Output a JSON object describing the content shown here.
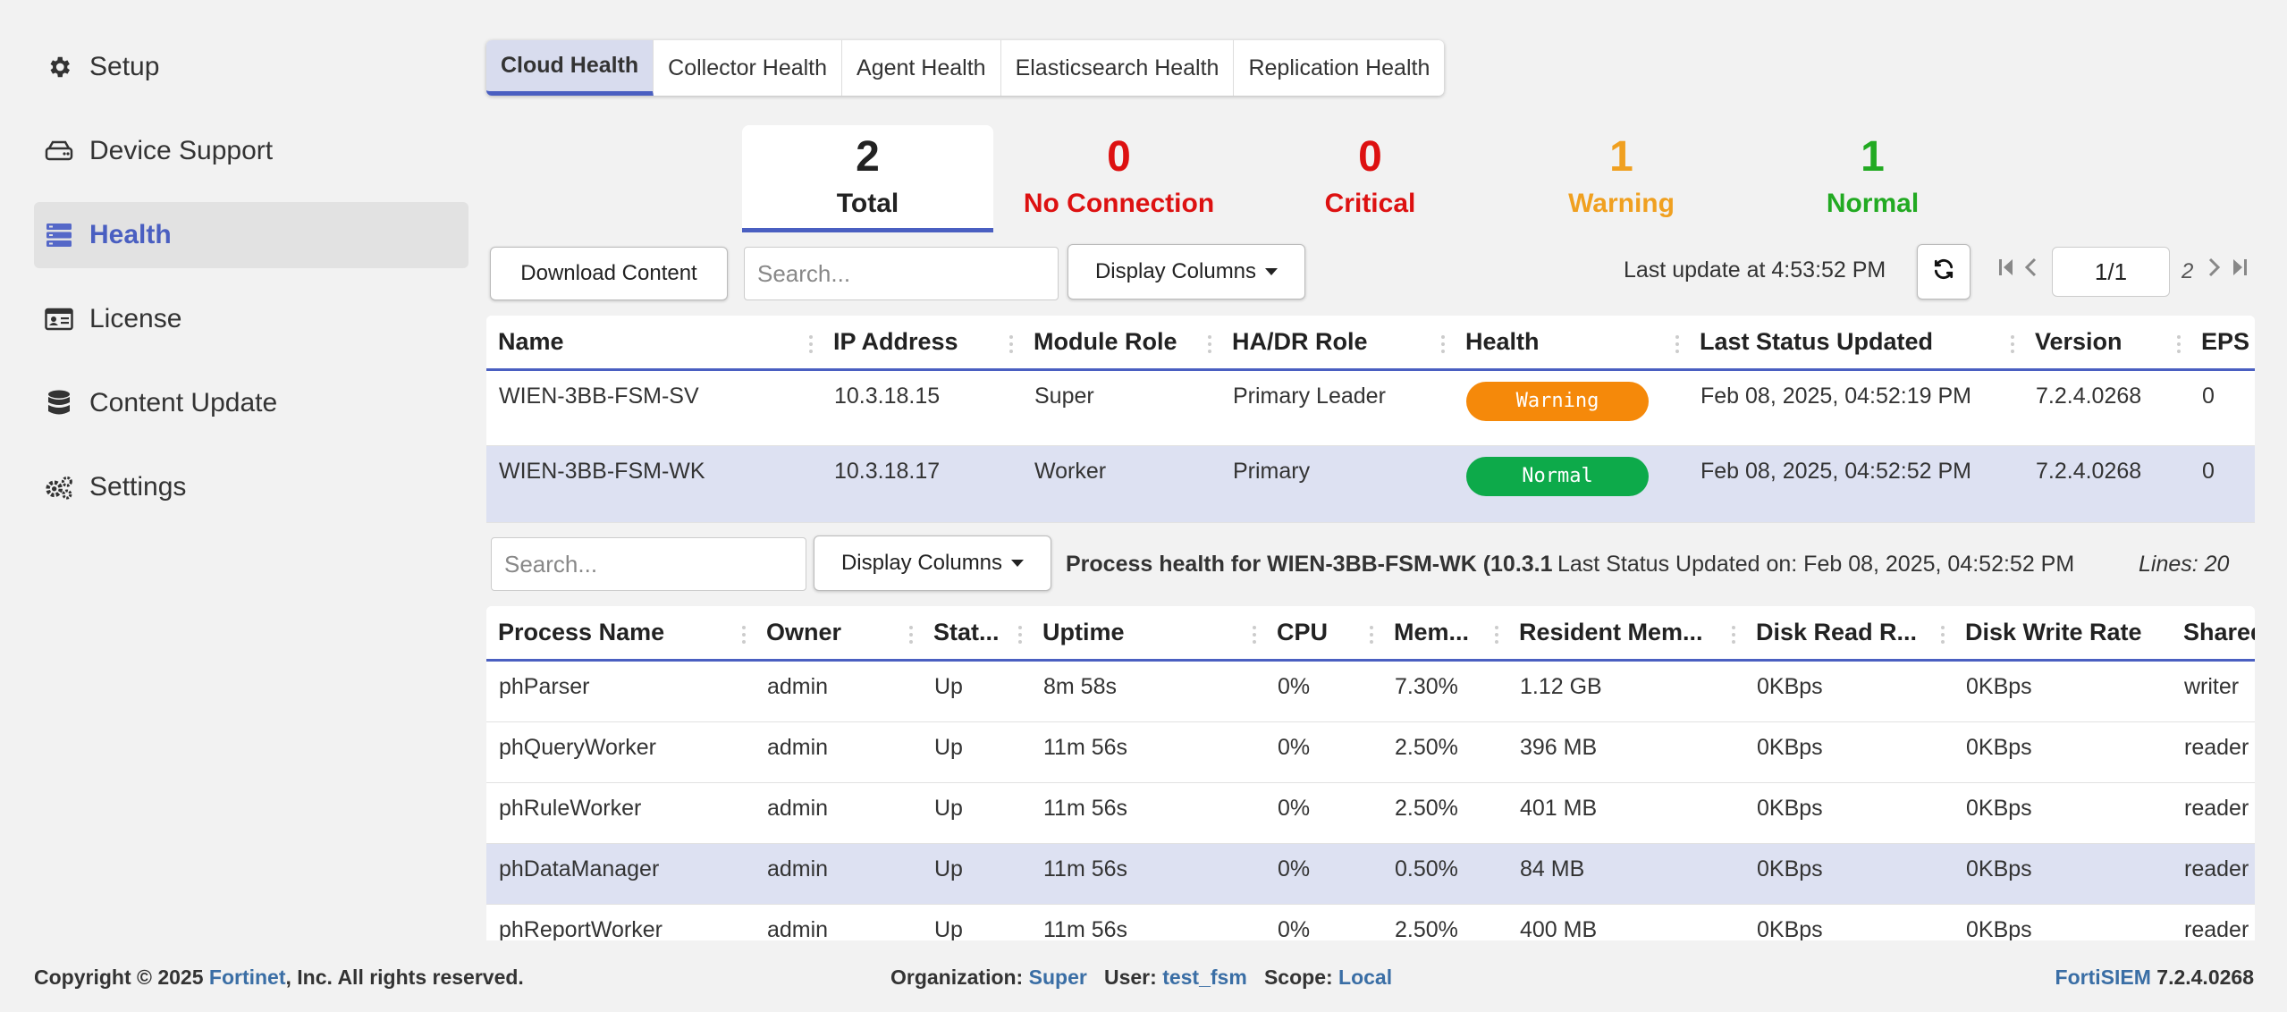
{
  "sidebar": {
    "items": [
      {
        "label": "Setup",
        "icon": "gear-icon"
      },
      {
        "label": "Device Support",
        "icon": "hard-drive-icon"
      },
      {
        "label": "Health",
        "icon": "server-icon",
        "active": true
      },
      {
        "label": "License",
        "icon": "id-card-icon"
      },
      {
        "label": "Content Update",
        "icon": "database-icon"
      },
      {
        "label": "Settings",
        "icon": "gears-icon"
      }
    ]
  },
  "tabs": [
    "Cloud Health",
    "Collector Health",
    "Agent Health",
    "Elasticsearch Health",
    "Replication Health"
  ],
  "summary": [
    {
      "count": "2",
      "label": "Total",
      "color": "#222222"
    },
    {
      "count": "0",
      "label": "No Connection",
      "color": "#dd1111"
    },
    {
      "count": "0",
      "label": "Critical",
      "color": "#dd1111"
    },
    {
      "count": "1",
      "label": "Warning",
      "color": "#f0a020"
    },
    {
      "count": "1",
      "label": "Normal",
      "color": "#22aa22"
    }
  ],
  "toolbar": {
    "download_label": "Download Content",
    "search_placeholder": "Search...",
    "display_columns_label": "Display Columns",
    "last_update": "Last update at 4:53:52 PM",
    "page_value": "1/1",
    "page_total": "2"
  },
  "nodes_table": {
    "columns": [
      "Name",
      "IP Address",
      "Module Role",
      "HA/DR Role",
      "Health",
      "Last Status Updated",
      "Version",
      "EPS"
    ],
    "rows": [
      {
        "name": "WIEN-3BB-FSM-SV",
        "ip": "10.3.18.15",
        "module_role": "Super",
        "hadr_role": "Primary Leader",
        "health": "Warning",
        "health_color": "#f5890a",
        "last_updated": "Feb 08, 2025, 04:52:19 PM",
        "version": "7.2.4.0268",
        "eps": "0"
      },
      {
        "name": "WIEN-3BB-FSM-WK",
        "ip": "10.3.18.17",
        "module_role": "Worker",
        "hadr_role": "Primary",
        "health": "Normal",
        "health_color": "#0daa4a",
        "last_updated": "Feb 08, 2025, 04:52:52 PM",
        "version": "7.2.4.0268",
        "eps": "0"
      }
    ]
  },
  "process": {
    "search_placeholder": "Search...",
    "display_columns_label": "Display Columns",
    "title": "Process health for WIEN-3BB-FSM-WK (10.3.1",
    "last_updated": "Last Status Updated on: Feb 08, 2025, 04:52:52 PM",
    "lines": "Lines: 20",
    "columns": [
      "Process Name",
      "Owner",
      "Stat...",
      "Uptime",
      "CPU",
      "Mem...",
      "Resident Mem...",
      "Disk Read R...",
      "Disk Write Rate",
      "Shared"
    ],
    "rows": [
      [
        "phParser",
        "admin",
        "Up",
        "8m 58s",
        "0%",
        "7.30%",
        "1.12 GB",
        "0KBps",
        "0KBps",
        "writer"
      ],
      [
        "phQueryWorker",
        "admin",
        "Up",
        "11m 56s",
        "0%",
        "2.50%",
        "396 MB",
        "0KBps",
        "0KBps",
        "reader"
      ],
      [
        "phRuleWorker",
        "admin",
        "Up",
        "11m 56s",
        "0%",
        "2.50%",
        "401 MB",
        "0KBps",
        "0KBps",
        "reader"
      ],
      [
        "phDataManager",
        "admin",
        "Up",
        "11m 56s",
        "0%",
        "0.50%",
        "84 MB",
        "0KBps",
        "0KBps",
        "reader"
      ],
      [
        "phReportWorker",
        "admin",
        "Up",
        "11m 56s",
        "0%",
        "2.50%",
        "400 MB",
        "0KBps",
        "0KBps",
        "reader"
      ]
    ]
  },
  "footer": {
    "copyright_prefix": "Copyright © 2025 ",
    "company": "Fortinet",
    "copyright_suffix": ", Inc. All rights reserved.",
    "org_label": "Organization:",
    "org_value": "Super",
    "user_label": "User:",
    "user_value": "test_fsm",
    "scope_label": "Scope:",
    "scope_value": "Local",
    "product": "FortiSIEM",
    "version": "7.2.4.0268"
  }
}
